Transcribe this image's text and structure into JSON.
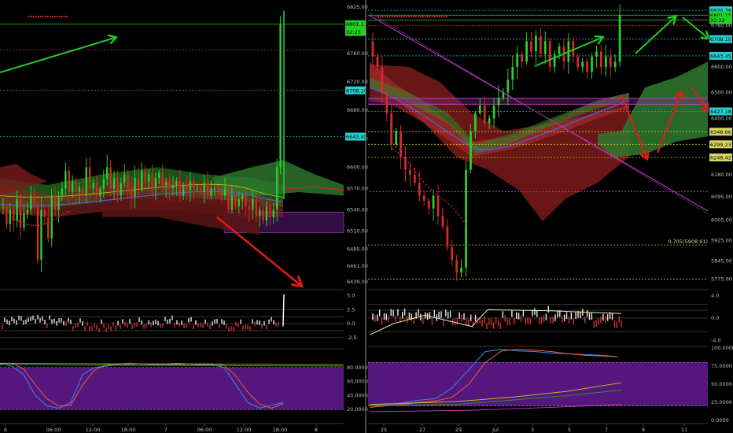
{
  "colors": {
    "background": "#000000",
    "bull": "#2ecc2e",
    "bear": "#d42a2a",
    "axis_text": "#bfbfbf",
    "cyan_line": "#1fb5b5",
    "red_dotted": "#c43a3a",
    "magenta": "#c040c0",
    "yellow": "#c8c820",
    "purple_zone": "#5a1a7a",
    "stoch_zone": "#5e1a8c",
    "cloud_green": "#2f7a2f",
    "cloud_red": "#7a1a1a",
    "arrow_green": "#22cc22",
    "arrow_red": "#e01b1b"
  },
  "chart_data": [
    {
      "panel": "left",
      "type": "candlestick",
      "timeframe_hint": "intraday",
      "x_labels": [
        "6",
        "06:00",
        "12:00",
        "18:00",
        "7",
        "06:00",
        "12:00",
        "18:00",
        "8"
      ],
      "y_ticks": [
        "6825.00",
        "6760.00",
        "6720.00",
        "6680.00",
        "6640.00",
        "6600.00",
        "6570.00",
        "6540.00",
        "6510.00",
        "6485.00",
        "6461.00",
        "6439.00"
      ],
      "ylim": [
        6430,
        6835
      ],
      "price_tags": [
        {
          "label": "6801.11",
          "value": 6801,
          "style": "green"
        },
        {
          "label": "32:23",
          "value": 6790,
          "style": "green"
        },
        {
          "label": "6708.10",
          "value": 6708,
          "style": "cyan"
        },
        {
          "label": "6643.45",
          "value": 6643,
          "style": "cyan"
        }
      ],
      "hlines": [
        {
          "value": 6801,
          "style": "green-solid"
        },
        {
          "value": 6765,
          "style": "red-dotted"
        },
        {
          "value": 6708,
          "style": "cyan-dotted"
        },
        {
          "value": 6643,
          "style": "cyan-dotted"
        }
      ],
      "candles_close": [
        6545,
        6520,
        6540,
        6525,
        6555,
        6515,
        6535,
        6540,
        6560,
        6548,
        6470,
        6540,
        6530,
        6500,
        6560,
        6540,
        6560,
        6570,
        6595,
        6565,
        6580,
        6565,
        6572,
        6560,
        6600,
        6570,
        6578,
        6560,
        6570,
        6583,
        6600,
        6570,
        6585,
        6560,
        6578,
        6590,
        6570,
        6558,
        6585,
        6570,
        6595,
        6580,
        6590,
        6572,
        6585,
        6592,
        6575,
        6580,
        6570,
        6575,
        6580,
        6560,
        6575,
        6568,
        6580,
        6570,
        6570,
        6565,
        6578,
        6560,
        6570,
        6570,
        6565,
        6560,
        6570,
        6540,
        6560,
        6545,
        6555,
        6560,
        6545,
        6540,
        6555,
        6532,
        6540,
        6525,
        6545,
        6530,
        6540,
        6600,
        6801
      ],
      "oscillator_ticks": [
        "5.0",
        "2.5",
        "0.0",
        "-2.5"
      ],
      "stochastic_ticks": [
        "80.0000",
        "60.0000",
        "40.0000",
        "20.0000"
      ]
    },
    {
      "panel": "right",
      "type": "candlestick",
      "timeframe_hint": "daily",
      "x_labels": [
        "25",
        "27",
        "29",
        "Jul",
        "3",
        "5",
        "7",
        "9",
        "11"
      ],
      "y_ticks": [
        "6820.78",
        "6801.11",
        "6760.00",
        "6708.10",
        "6643.45",
        "6600.00",
        "6500.00",
        "6400.00",
        "6340.00",
        "6248.50",
        "6180.00",
        "6095.00",
        "6005.00",
        "5925.00",
        "5845.00",
        "5775.00"
      ],
      "ylim": [
        5740,
        6860
      ],
      "price_tags": [
        {
          "label": "6820.78",
          "value": 6820,
          "style": "cyan"
        },
        {
          "label": "6801.11",
          "value": 6801,
          "style": "green"
        },
        {
          "label": "32:22",
          "value": 6782,
          "style": "green"
        },
        {
          "label": "6708.10",
          "value": 6708,
          "style": "cyan"
        },
        {
          "label": "6643.45",
          "value": 6643,
          "style": "cyan"
        },
        {
          "label": "6427.18",
          "value": 6427,
          "style": "cyan"
        },
        {
          "label": "6348.66",
          "value": 6348,
          "style": "yellow"
        },
        {
          "label": "6299.23",
          "value": 6299,
          "style": "yellow"
        },
        {
          "label": "6248.42",
          "value": 6248,
          "style": "yellow"
        }
      ],
      "annotations": [
        {
          "text": "0.705(5908.91)",
          "value": 5908
        }
      ],
      "oscillator_ticks": [
        "4.0",
        "0.0",
        "-4.0"
      ],
      "stochastic_ticks": [
        "100.0000",
        "75.0000",
        "50.0000",
        "25.0000",
        "0.0000"
      ]
    }
  ]
}
